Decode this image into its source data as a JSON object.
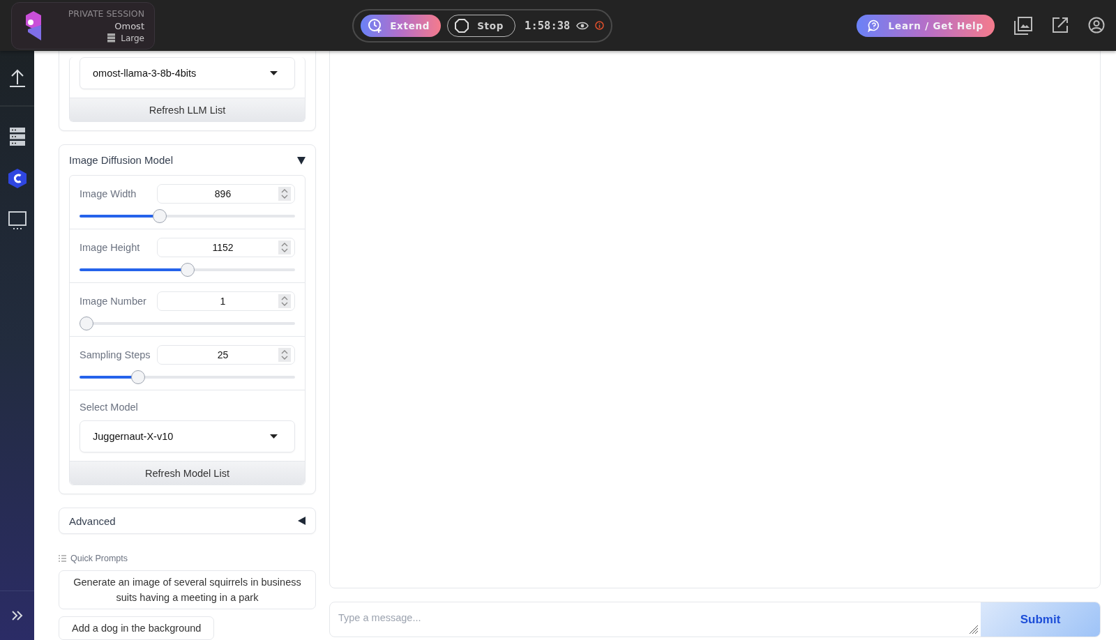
{
  "session": {
    "label": "PRIVATE SESSION",
    "app": "Omost",
    "size": "Large"
  },
  "session_controls": {
    "extend": "Extend",
    "stop": "Stop",
    "timer": "1:58:38"
  },
  "help_button": "Learn / Get Help",
  "llm_card": {
    "model": "omost-llama-3-8b-4bits",
    "refresh": "Refresh LLM List"
  },
  "diffusion_card": {
    "title": "Image Diffusion Model",
    "expanded": true,
    "sliders": [
      {
        "label": "Image Width",
        "value": "896",
        "level": 0.365
      },
      {
        "label": "Image Height",
        "value": "1152",
        "level": 0.5
      },
      {
        "label": "Image Number",
        "value": "1",
        "level": 0
      },
      {
        "label": "Sampling Steps",
        "value": "25",
        "level": 0.257
      }
    ],
    "select_label": "Select Model",
    "model": "Juggernaut-X-v10",
    "refresh": "Refresh Model List"
  },
  "advanced": {
    "title": "Advanced",
    "expanded": false
  },
  "quick_prompts": {
    "title": "Quick Prompts",
    "items": [
      "Generate an image of several squirrels in business suits having a meeting in a park",
      "Add a dog in the background"
    ]
  },
  "message": {
    "placeholder": "Type a message...",
    "submit": "Submit"
  }
}
